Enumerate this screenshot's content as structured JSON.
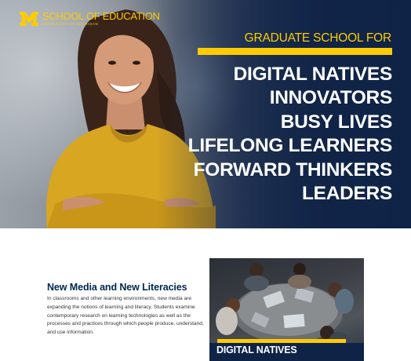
{
  "logo": {
    "title": "SCHOOL OF EDUCATION",
    "subtitle": "UNIVERSITY OF MICHIGAN",
    "mark": "block-m-icon",
    "color": "#ffcb05"
  },
  "hero": {
    "kicker": "GRADUATE SCHOOL FOR",
    "lines": [
      "DIGITAL NATIVES",
      "INNOVATORS",
      "BUSY LIVES",
      "LIFELONG LEARNERS",
      "FORWARD THINKERS",
      "LEADERS"
    ],
    "accent_color": "#ffcb05",
    "navy_color": "#0f2347"
  },
  "section": {
    "title": "New Media and New Literacies",
    "body": "In classrooms and other learning environments, new media are expanding the notions of learning and literacy. Students examine contemporary research on learning technologies as well as the processes and practices through which people produce, understand, and use information."
  },
  "card": {
    "label": "DIGITAL NATIVES"
  }
}
